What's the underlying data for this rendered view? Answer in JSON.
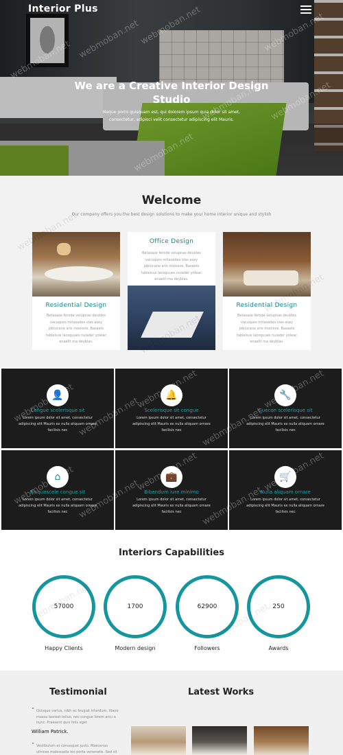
{
  "header": {
    "brand": "Interior Plus",
    "menu_icon": "hamburger-icon"
  },
  "hero": {
    "title": "We are a Creative Interior Design Studio",
    "subtitle": "Neque porro quisquam est, qui dolorem ipsum quia dolor sit amet, consectetur, adipisci velit consectetur adipiscing elit Mauris."
  },
  "welcome": {
    "title": "Welcome",
    "subtitle": "Our company offers you the best design solutions to make your home interior unique and stylish",
    "cards": [
      {
        "title": "Residential Design",
        "text": "Betasaze ferode velupnas deuldes vacuques mitasades vias asey jobiucane aris mooisve. Basaets tablelsus lacoquues nulader yoleac enaelit ma deyblas."
      },
      {
        "title": "Office Design",
        "text": "Betasaze ferode velupnas deuldes vacuques mitasades vias asey jobiucane aris mooisve. Basaets tablelsus lacoquues nulader yoleac enaelit ma deyblas."
      },
      {
        "title": "Residential Design",
        "text": "Betasaze ferode velupnas deuldes vacuques mitasades vias asey jobiucane aris mooisve. Basaets tablelsus lacoquues nulader yoleac enaelit ma deyblas."
      }
    ]
  },
  "services": [
    {
      "icon": "person-icon",
      "glyph": "👤",
      "title": "Congue scelerisque sit",
      "text": "Lorem ipsum dolor sit amet, consectetur adipiscing elit Mauris ex nulla aliquam ornare facilisis nec"
    },
    {
      "icon": "bell-icon",
      "glyph": "🔔",
      "title": "Scelerisque sit congue",
      "text": "Lorem ipsum dolor sit amet, consectetur adipiscing elit Mauris ex nulla aliquam ornare facilisis nec"
    },
    {
      "icon": "wrench-icon",
      "glyph": "🔧",
      "title": "Guecon scelerisque sit",
      "text": "Lorem ipsum dolor sit amet, consectetur adipiscing elit Mauris ex nulla aliquam ornare facilisis nec"
    },
    {
      "icon": "home-icon",
      "glyph": "⌂",
      "title": "Risquescele congue sit",
      "text": "Lorem ipsum dolor sit amet, consectetur adipiscing elit Mauris ex nulla aliquam ornare facilisis nec"
    },
    {
      "icon": "briefcase-icon",
      "glyph": "💼",
      "title": "Bibendum iure minimo",
      "text": "Lorem ipsum dolor sit amet, consectetur adipiscing elit Mauris ex nulla aliquam ornare facilisis nec"
    },
    {
      "icon": "cart-icon",
      "glyph": "🛒",
      "title": "Nulla aliquam ornare",
      "text": "Lorem ipsum dolor sit amet, consectetur adipiscing elit Mauris ex nulla aliquam ornare facilisis nec"
    }
  ],
  "capabilities": {
    "title": "Interiors Capabilities",
    "counters": [
      {
        "value": "57000",
        "label": "Happy Clients"
      },
      {
        "value": "1700",
        "label": "Modern design"
      },
      {
        "value": "62900",
        "label": "Followers"
      },
      {
        "value": "250",
        "label": "Awards"
      }
    ]
  },
  "testimonial": {
    "title": "Testimonial",
    "quotes": [
      {
        "text": "Quisque varius, nibh ac feugiat interdum, libero massa laoreet tellus, nec congue lorem arcu a nunc. Praesent quis felis eget",
        "name": "William Patrick."
      },
      {
        "text": "Vestibulum et consequat justo. Maecenas ultrices malesuada leo porta venenatis. Sed sit amet diam"
      }
    ]
  },
  "latest_works": {
    "title": "Latest Works"
  },
  "watermark": "webmoban.net"
}
